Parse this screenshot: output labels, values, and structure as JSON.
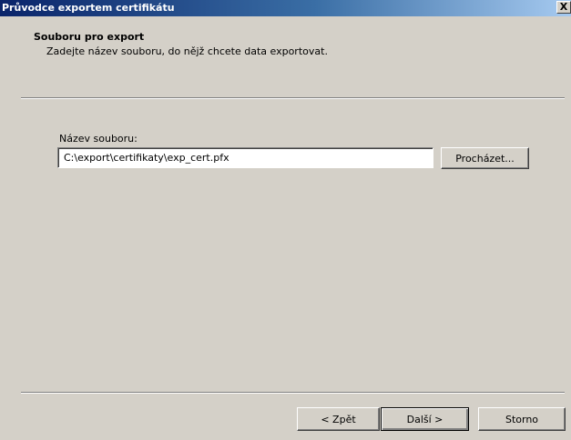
{
  "window": {
    "title": "Průvodce exportem certifikátu",
    "close_label": "X"
  },
  "header": {
    "title": "Souboru pro export",
    "subtitle": "Zadejte název souboru, do nějž chcete data exportovat."
  },
  "form": {
    "file_label": "Název souboru:",
    "file_value": "C:\\export\\certifikaty\\exp_cert.pfx",
    "browse_label": "Procházet..."
  },
  "footer": {
    "back_label": "< Zpět",
    "next_label": "Další >",
    "cancel_label": "Storno"
  }
}
